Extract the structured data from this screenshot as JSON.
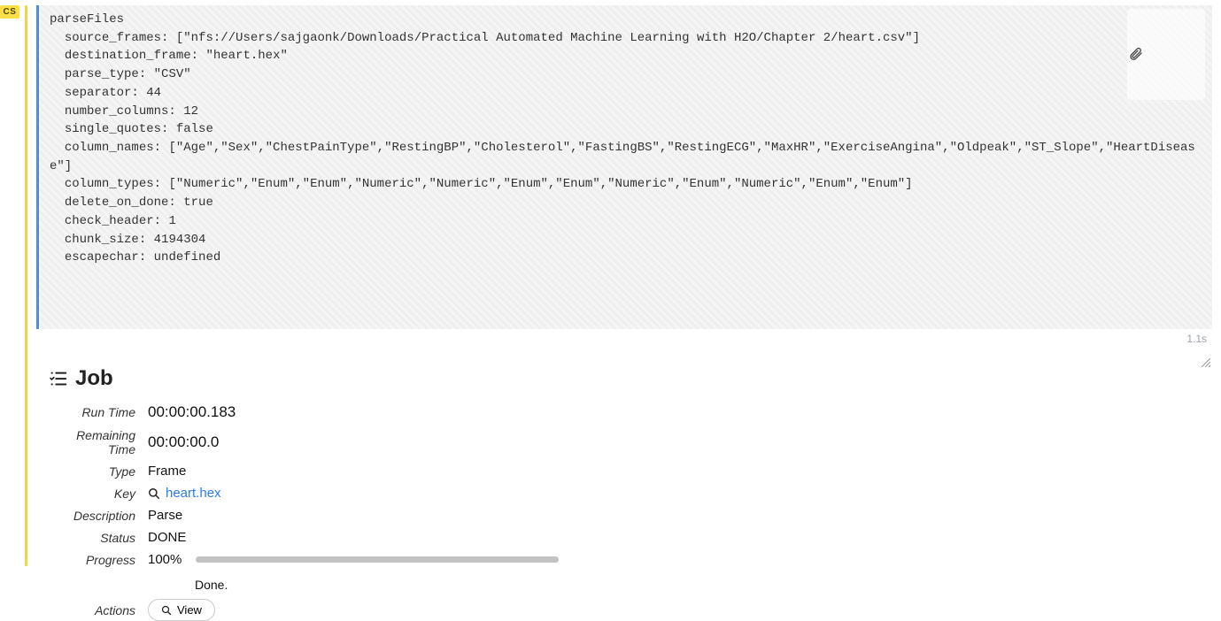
{
  "cell_tag": "CS",
  "code": {
    "fn": "parseFiles",
    "params": {
      "source_frames": "[\"nfs://Users/sajgaonk/Downloads/Practical Automated Machine Learning with H2O/Chapter 2/heart.csv\"]",
      "destination_frame": "\"heart.hex\"",
      "parse_type": "\"CSV\"",
      "separator": "44",
      "number_columns": "12",
      "single_quotes": "false",
      "column_names": "[\"Age\",\"Sex\",\"ChestPainType\",\"RestingBP\",\"Cholesterol\",\"FastingBS\",\"RestingECG\",\"MaxHR\",\"ExerciseAngina\",\"Oldpeak\",\"ST_Slope\",\"HeartDisease\"]",
      "column_types": "[\"Numeric\",\"Enum\",\"Enum\",\"Numeric\",\"Numeric\",\"Enum\",\"Enum\",\"Numeric\",\"Enum\",\"Numeric\",\"Enum\",\"Enum\"]",
      "delete_on_done": "true",
      "check_header": "1",
      "chunk_size": "4194304",
      "escapechar": "undefined"
    }
  },
  "timing": "1.1s",
  "job": {
    "title": "Job",
    "labels": {
      "run_time": "Run Time",
      "remaining_time": "Remaining Time",
      "type": "Type",
      "key": "Key",
      "description": "Description",
      "status": "Status",
      "progress": "Progress",
      "actions": "Actions"
    },
    "run_time": "00:00:00.183",
    "remaining_time": "00:00:00.0",
    "type": "Frame",
    "key": "heart.hex",
    "description": "Parse",
    "status": "DONE",
    "progress_pct": "100%",
    "progress_msg": "Done.",
    "view_label": "View"
  }
}
